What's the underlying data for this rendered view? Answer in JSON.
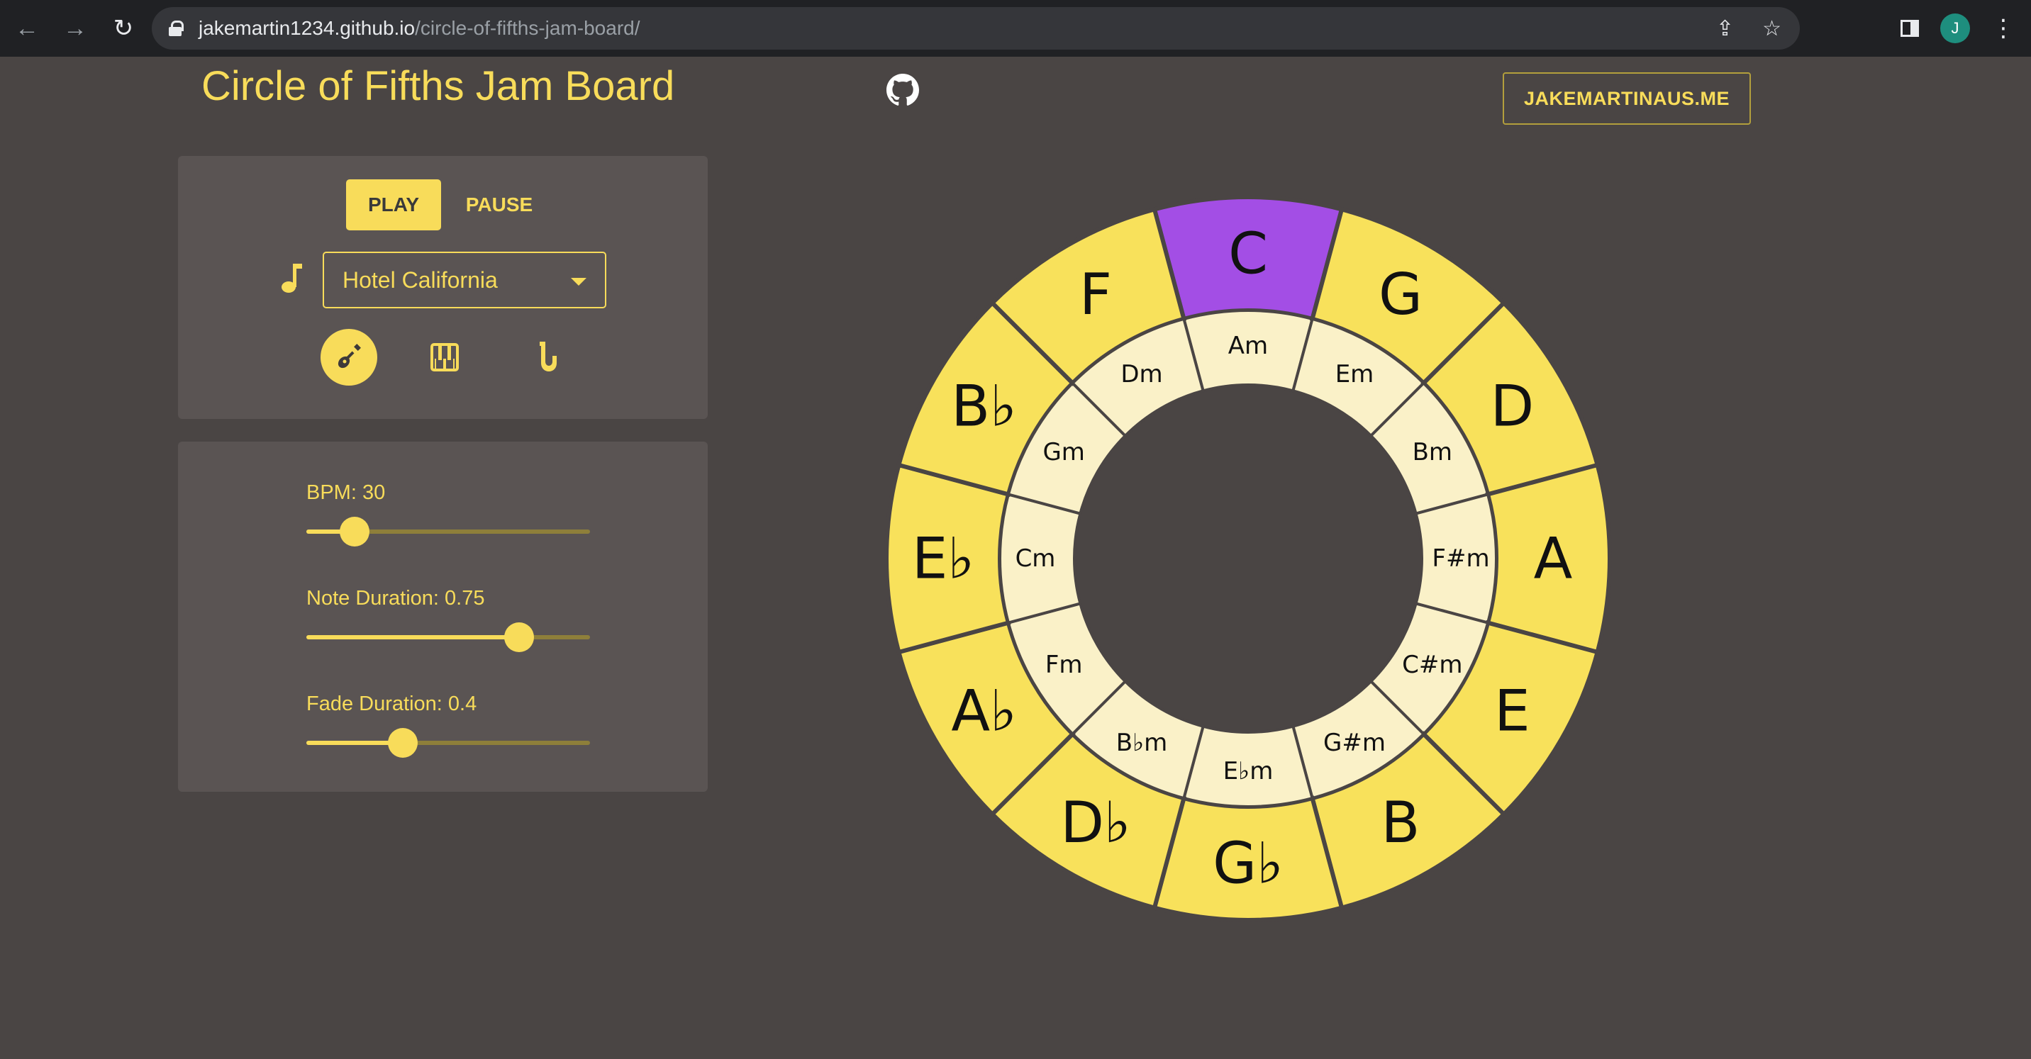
{
  "browser": {
    "url_host": "jakemartin1234.github.io",
    "url_path": "/circle-of-fifths-jam-board/",
    "profile_initial": "J",
    "icons": [
      "back-arrow-icon",
      "forward-arrow-icon",
      "reload-icon",
      "lock-icon",
      "share-icon",
      "star-icon",
      "side-panel-icon",
      "kebab-menu-icon"
    ]
  },
  "header": {
    "title": "Circle of Fifths Jam Board",
    "github_icon": "github-icon",
    "site_link": "JAKEMARTINAUS.ME"
  },
  "controls": {
    "play_label": "PLAY",
    "pause_label": "PAUSE",
    "song_icon": "music-note-icon",
    "song_selected": "Hotel California",
    "instruments": [
      {
        "name": "guitar",
        "icon": "guitar-icon",
        "selected": true
      },
      {
        "name": "piano",
        "icon": "piano-icon",
        "selected": false
      },
      {
        "name": "saxophone",
        "icon": "saxophone-icon",
        "selected": false
      }
    ]
  },
  "sliders": {
    "bpm": {
      "label": "BPM: 30",
      "fraction": 0.17
    },
    "note_duration": {
      "label": "Note Duration: 0.75",
      "fraction": 0.75
    },
    "fade_duration": {
      "label": "Fade Duration: 0.4",
      "fraction": 0.34
    }
  },
  "circle": {
    "colors": {
      "major": "#f8e15b",
      "major_active": "#a34ee5",
      "minor": "#faf1c8",
      "separator": "#4a4544",
      "text": "#111111"
    },
    "active_index": 0,
    "major_keys": [
      "C",
      "G",
      "D",
      "A",
      "E",
      "B",
      "G♭",
      "D♭",
      "A♭",
      "E♭",
      "B♭",
      "F"
    ],
    "minor_keys": [
      "Am",
      "Em",
      "Bm",
      "F#m",
      "C#m",
      "G#m",
      "E♭m",
      "B♭m",
      "Fm",
      "Cm",
      "Gm",
      "Dm"
    ]
  }
}
